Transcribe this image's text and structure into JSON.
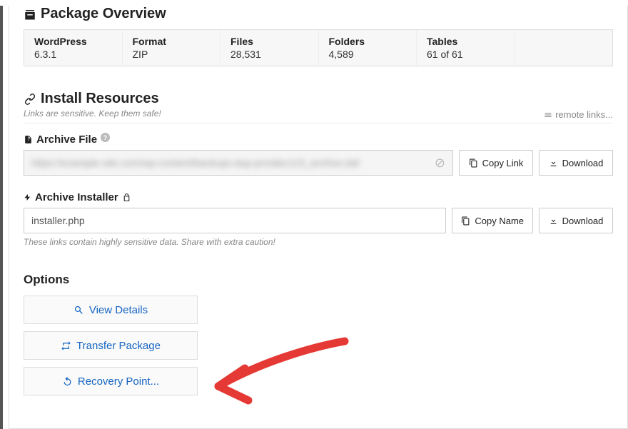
{
  "overview": {
    "title": "Package Overview",
    "cols": [
      {
        "label": "WordPress",
        "value": "6.3.1"
      },
      {
        "label": "Format",
        "value": "ZIP"
      },
      {
        "label": "Files",
        "value": "28,531"
      },
      {
        "label": "Folders",
        "value": "4,589"
      },
      {
        "label": "Tables",
        "value": "61 of 61"
      }
    ]
  },
  "install": {
    "title": "Install Resources",
    "subtitle": "Links are sensitive. Keep them safe!",
    "remote_links": "remote links..."
  },
  "archive_file": {
    "label": "Archive File",
    "value_masked": "https://example-site.com/wp-content/backups-dup-pro/abc123_archive.daf",
    "copy_label": "Copy Link",
    "download_label": "Download"
  },
  "archive_installer": {
    "label": "Archive Installer",
    "value": "installer.php",
    "copy_label": "Copy Name",
    "download_label": "Download",
    "warning": "These links contain highly sensitive data. Share with extra caution!"
  },
  "options": {
    "title": "Options",
    "view_details": "View Details",
    "transfer": "Transfer Package",
    "recovery": "Recovery Point..."
  }
}
